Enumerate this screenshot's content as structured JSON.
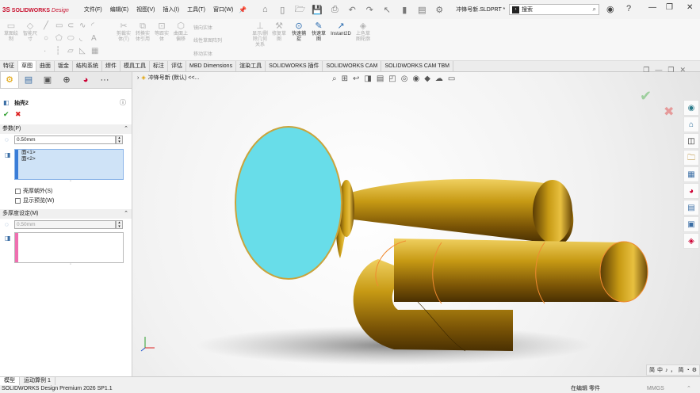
{
  "app": {
    "logo_ds": "3S",
    "logo_name": "SOLIDWORKS",
    "logo_design": "Design",
    "doc_title": "冲锋号新.SLDPRT *",
    "search_placeholder": "搜索"
  },
  "menu": [
    "文件(F)",
    "编辑(E)",
    "视图(V)",
    "插入(I)",
    "工具(T)",
    "窗口(W)"
  ],
  "ribbon": {
    "buttons": [
      {
        "label": "草图绘制",
        "icon": "▭"
      },
      {
        "label": "智能尺寸",
        "icon": "◇"
      },
      {
        "label": "剪裁实体(T)",
        "icon": "✂"
      },
      {
        "label": "转换实体引用",
        "icon": "⧉"
      },
      {
        "label": "等距实体",
        "icon": "⊡"
      },
      {
        "label": "曲面上偏移",
        "icon": "⬡"
      },
      {
        "label": "镜向实体",
        "icon": "⇿"
      },
      {
        "label": "线性草图阵列",
        "icon": "▦"
      },
      {
        "label": "显示/删除几何关系",
        "icon": "⊥"
      },
      {
        "label": "修复草图",
        "icon": "⚒"
      },
      {
        "label": "快速捕捉",
        "icon": "⊙"
      },
      {
        "label": "快速草图",
        "icon": "✎"
      },
      {
        "label": "Instant2D",
        "icon": "↗"
      },
      {
        "label": "上色草图轮廓",
        "icon": "◈"
      }
    ],
    "small": [
      "镜向实体",
      "线性草图阵列",
      "移动实体"
    ]
  },
  "command_tabs": [
    "特征",
    "草图",
    "曲面",
    "钣金",
    "结构系统",
    "焊件",
    "模具工具",
    "标注",
    "评估",
    "MBD Dimensions",
    "渲染工具",
    "SOLIDWORKS 插件",
    "SOLIDWORKS CAM",
    "SOLIDWORKS CAM TBM"
  ],
  "active_command_tab": "草图",
  "property_manager": {
    "title": "抽壳2",
    "ok": "✔",
    "cancel": "✖",
    "params_header": "参数(P)",
    "thickness": "0.50mm",
    "faces": [
      "面<1>",
      "面<2>"
    ],
    "shell_outward": "壳厚朝外(S)",
    "show_preview": "显示预览(W)",
    "multi_header": "多厚度设定(M)",
    "multi_thickness": "0.50mm"
  },
  "viewport": {
    "tree_label": "冲锋号新 (默认) <<..."
  },
  "ime": {
    "items": [
      "简",
      "中",
      "♪",
      "，",
      "简",
      "◔",
      "⚙"
    ]
  },
  "bottom_tabs": [
    "模型",
    "运动算例 1"
  ],
  "status": {
    "left": "SOLIDWORKS Design Premium 2026 SP1.1",
    "mode": "在编辑 零件",
    "units": "MMGS"
  }
}
